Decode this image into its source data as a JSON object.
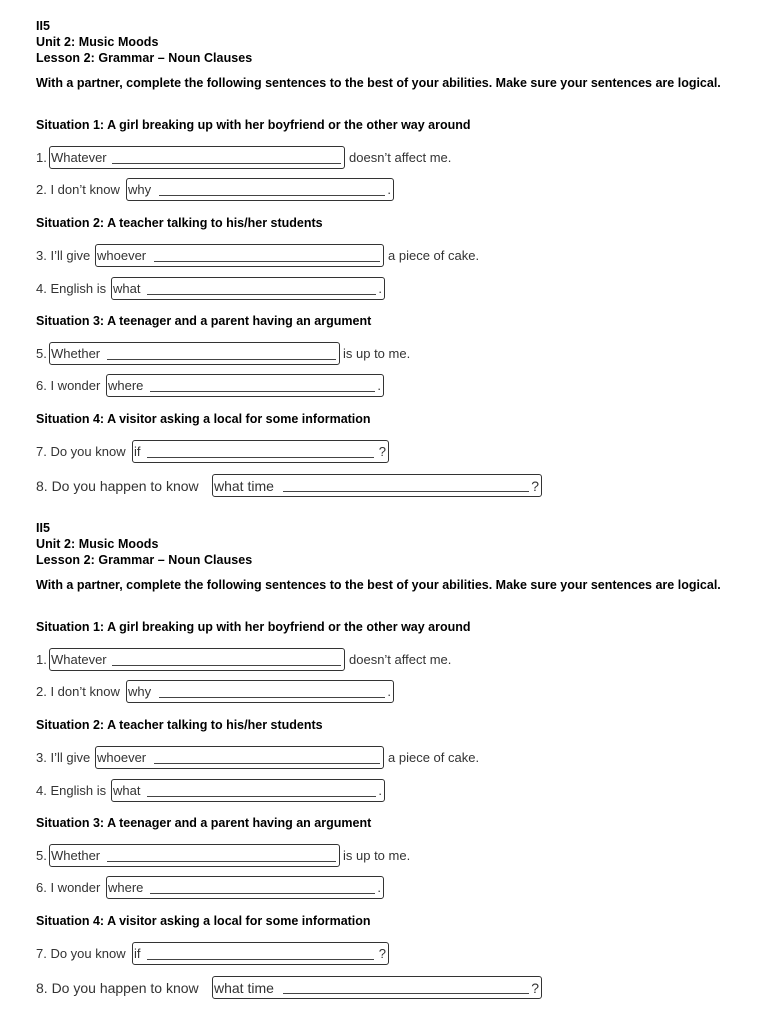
{
  "worksheet": {
    "code": "II5",
    "unit": "Unit 2: Music Moods",
    "lesson": "Lesson 2: Grammar – Noun Clauses",
    "instructions": "With a partner, complete the following sentences to the best of your abilities. Make sure your sentences are logical.",
    "situations": [
      "Situation 1: A girl breaking up with her boyfriend or the other way around",
      "Situation 2: A teacher talking to his/her students",
      "Situation 3: A teenager and a parent having an argument",
      "Situation 4: A visitor asking a local for some information"
    ],
    "items": [
      {
        "lead": "1.",
        "fill": "Whatever",
        "end": "",
        "tail": "doesn’t affect me."
      },
      {
        "lead": "2. I don’t know",
        "fill": "why",
        "end": ".",
        "tail": ""
      },
      {
        "lead": "3. I’ll give",
        "fill": "whoever",
        "end": "",
        "tail": "a piece of cake."
      },
      {
        "lead": "4. English is",
        "fill": "what",
        "end": ".",
        "tail": ""
      },
      {
        "lead": "5.",
        "fill": "Whether",
        "end": "",
        "tail": "is up to me."
      },
      {
        "lead": "6. I wonder",
        "fill": "where",
        "end": ".",
        "tail": ""
      },
      {
        "lead": "7. Do you know",
        "fill": "if",
        "end": "?",
        "tail": ""
      },
      {
        "lead": "8. Do you happen to know",
        "fill": "what time",
        "end": "?",
        "tail": ""
      }
    ],
    "copies": 2
  }
}
